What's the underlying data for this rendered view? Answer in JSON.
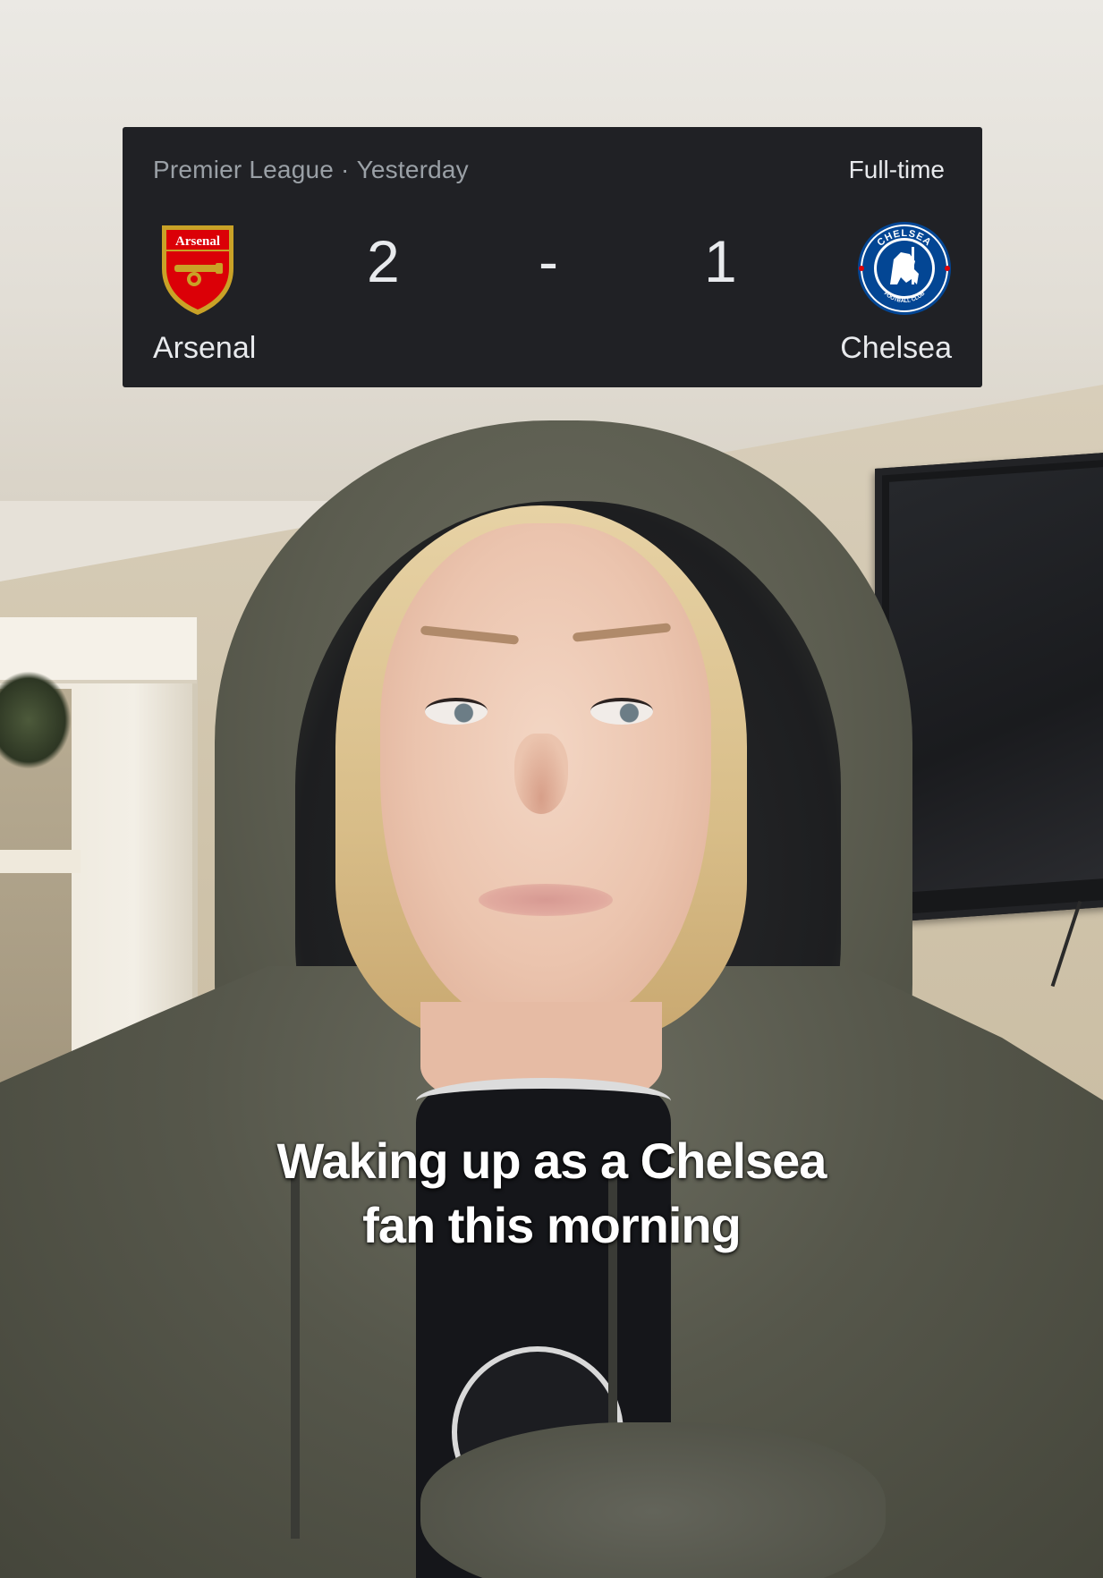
{
  "scoreboard": {
    "competition": "Premier League",
    "separator": "·",
    "date": "Yesterday",
    "status": "Full-time",
    "home": {
      "team": "Arsenal",
      "score": "2",
      "badge_text": "Arsenal",
      "badge_icon": "arsenal-crest-icon",
      "color": "#db0007"
    },
    "score_dash": "-",
    "away": {
      "team": "Chelsea",
      "score": "1",
      "badge_text_top": "CHELSEA",
      "badge_text_bottom": "FOOTBALL CLUB",
      "badge_icon": "chelsea-crest-icon",
      "color": "#034694"
    }
  },
  "caption": {
    "line1": "Waking up as a Chelsea",
    "line2": "fan this morning"
  }
}
